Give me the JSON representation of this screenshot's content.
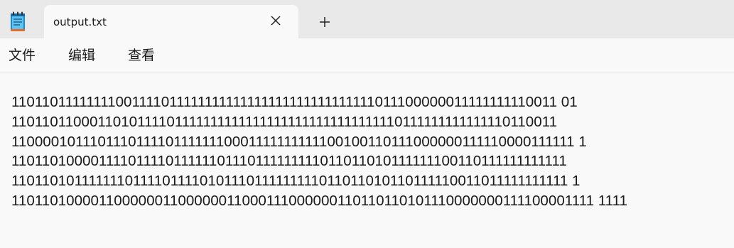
{
  "app": {
    "icon": "notepad-icon"
  },
  "tab": {
    "title": "output.txt",
    "close_icon": "close-icon",
    "new_tab_icon": "plus-icon"
  },
  "menu": {
    "file": "文件",
    "edit": "编辑",
    "view": "查看"
  },
  "editor": {
    "lines": [
      "11011011111111001111011111111111111111111111111111011100000011111111110011 01",
      "11011011000110101111011111111111111111111111111111110111111111111110110011",
      "11000010111011101111011111110001111111111100100110111000000111110000111111 1",
      "11011010000111101111011111101110111111111011011010111111100110111111111111",
      "11011010111111101111011110101110111111111011011010110111110011011111111111 1",
      "11011010000110000001100000011000111000000110110110101110000000111100001111 1111"
    ]
  },
  "colors": {
    "tabbar_bg": "#e9e9e9",
    "page_bg": "#f9f9f9",
    "text": "#1a1a1a"
  }
}
